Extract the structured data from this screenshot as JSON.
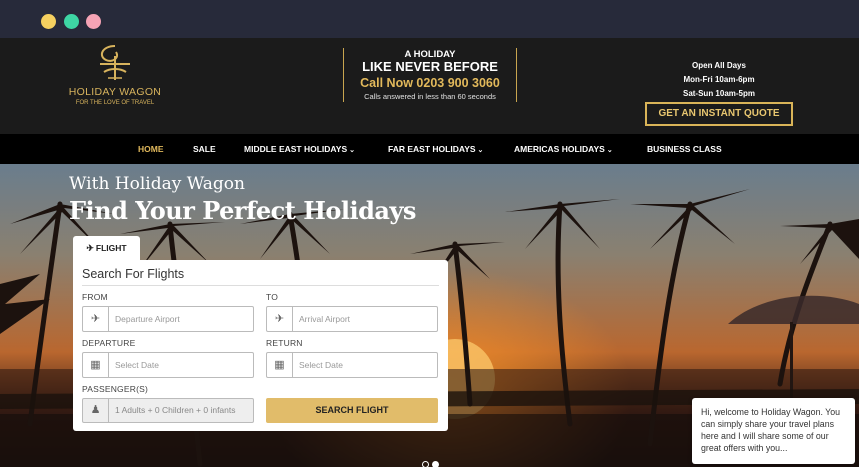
{
  "header": {
    "logo": {
      "brand": "HOLIDAY WAGON",
      "tagline": "FOR THE LOVE OF TRAVEL"
    },
    "promo": {
      "line1": "A HOLIDAY",
      "line2": "LIKE NEVER BEFORE",
      "phone": "Call Now 0203 900 3060",
      "note": "Calls answered in less than 60 seconds"
    },
    "hours": {
      "line1": "Open All Days",
      "line2": "Mon-Fri 10am-6pm",
      "line3": "Sat-Sun 10am-5pm"
    },
    "quote_button": "GET AN INSTANT QUOTE"
  },
  "nav": {
    "items": [
      {
        "label": "HOME",
        "active": true
      },
      {
        "label": "SALE"
      },
      {
        "label": "MIDDLE EAST HOLIDAYS",
        "dropdown": true
      },
      {
        "label": "FAR EAST HOLIDAYS",
        "dropdown": true
      },
      {
        "label": "AMERICAS HOLIDAYS",
        "dropdown": true
      },
      {
        "label": "BUSINESS CLASS"
      }
    ]
  },
  "hero": {
    "subtitle": "With Holiday Wagon",
    "title": "Find Your Perfect Holidays"
  },
  "search": {
    "tab_label": "FLIGHT",
    "title": "Search For Flights",
    "from_label": "FROM",
    "to_label": "TO",
    "from_placeholder": "Departure Airport",
    "to_placeholder": "Arrival Airport",
    "departure_label": "DEPARTURE",
    "return_label": "RETURN",
    "departure_placeholder": "Select Date",
    "return_placeholder": "Select Date",
    "passengers_label": "PASSENGER(S)",
    "passengers_value": "1 Adults + 0 Children + 0 infants",
    "search_button": "SEARCH FLIGHT"
  },
  "carousel": {
    "slides": 2,
    "active": 2
  },
  "chat": {
    "message": "Hi, welcome to Holiday Wagon. You can simply share your travel plans here and I will share some of our great offers with you..."
  },
  "colors": {
    "accent_gold": "#e1bc6a",
    "header_bg": "#1b1b1b",
    "nav_bg": "#000000"
  }
}
